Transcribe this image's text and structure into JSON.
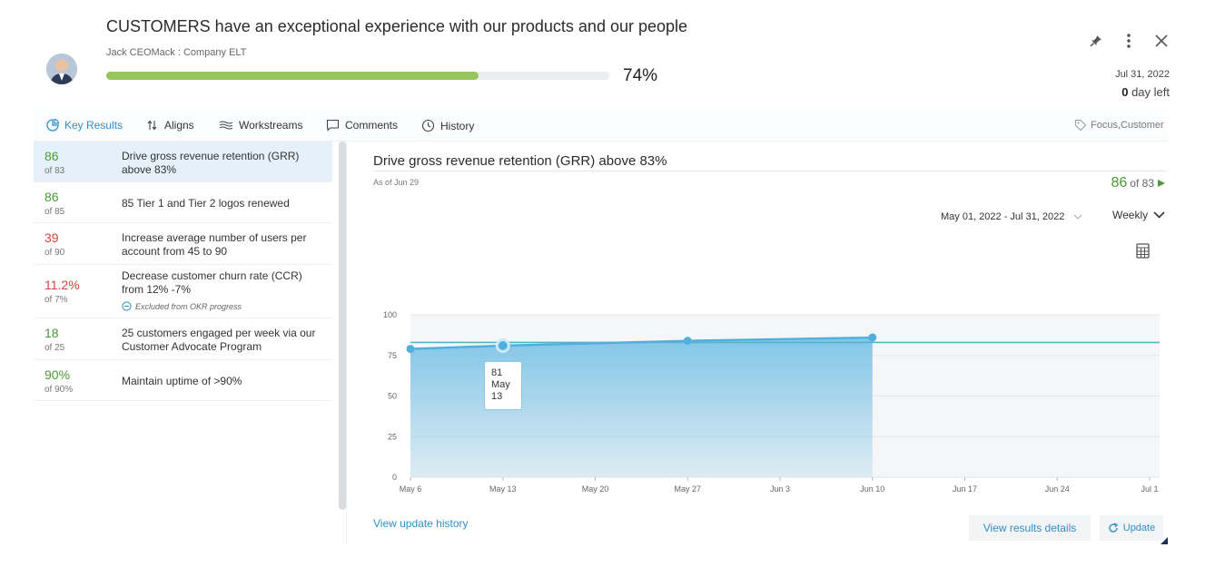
{
  "header": {
    "title": "CUSTOMERS have an exceptional experience with our products and our people",
    "owner": "Jack CEOMack : Company ELT",
    "progress_pct": 74,
    "progress_label": "74%",
    "due_date": "Jul 31, 2022",
    "days_left_num": "0",
    "days_left_text": "day left",
    "icons": [
      "pin-icon",
      "more-vertical-icon",
      "close-icon"
    ]
  },
  "tabs": [
    {
      "label": "Key Results",
      "icon": "pie-chart-icon",
      "active": true
    },
    {
      "label": "Aligns",
      "icon": "align-arrows-icon"
    },
    {
      "label": "Workstreams",
      "icon": "workstreams-icon"
    },
    {
      "label": "Comments",
      "icon": "comment-icon"
    },
    {
      "label": "History",
      "icon": "clock-icon"
    }
  ],
  "tags": "Focus,Customer",
  "key_results": [
    {
      "value": "86",
      "of": "of 83",
      "desc": "Drive gross revenue retention (GRR) above 83%",
      "status": "green",
      "selected": true
    },
    {
      "value": "86",
      "of": "of 85",
      "desc": "85 Tier 1 and Tier 2 logos renewed",
      "status": "green"
    },
    {
      "value": "39",
      "of": "of 90",
      "desc": "Increase average number of users per account from 45 to 90",
      "status": "red"
    },
    {
      "value": "11.2%",
      "of": "of 7%",
      "desc": "Decrease customer churn rate (CCR) from 12% -7%",
      "status": "red",
      "note": "Excluded from OKR progress"
    },
    {
      "value": "18",
      "of": "of 25",
      "desc": "25 customers engaged per week via our Customer Advocate Program",
      "status": "green"
    },
    {
      "value": "90%",
      "of": "of 90%",
      "desc": "Maintain uptime of >90%",
      "status": "green"
    }
  ],
  "detail": {
    "title": "Drive gross revenue retention (GRR) above 83%",
    "as_of": "As of Jun 29",
    "current_value": "86",
    "current_of": "of 83",
    "date_range": "May 01, 2022 - Jul 31, 2022",
    "frequency": "Weekly",
    "tooltip": {
      "value": "81",
      "month": "May",
      "day": "13"
    },
    "view_history": "View update history",
    "view_details": "View results details",
    "update": "Update"
  },
  "chart_data": {
    "type": "area",
    "x_ticks": [
      "May 6",
      "May 13",
      "May 20",
      "May 27",
      "Jun 3",
      "Jun 10",
      "Jun 17",
      "Jun 24",
      "Jul 1"
    ],
    "y_ticks": [
      0,
      25,
      50,
      75,
      100
    ],
    "ylim": [
      0,
      100
    ],
    "target": 83,
    "series": [
      {
        "x": [
          "May 6",
          "May 13",
          "May 27",
          "Jun 10"
        ],
        "values": [
          79,
          81,
          84,
          86
        ]
      }
    ],
    "highlight": {
      "x": "May 13",
      "value": 81
    },
    "colors": {
      "area": "#7cc3e6",
      "line": "#4fb0de",
      "target": "#52b4c9"
    }
  }
}
